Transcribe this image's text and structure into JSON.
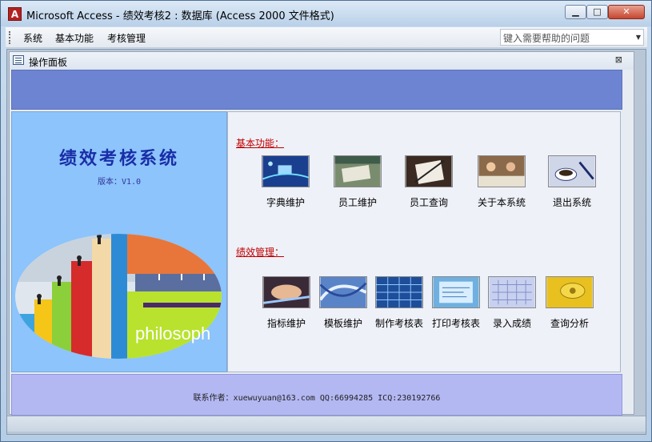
{
  "window": {
    "app_icon_letter": "A",
    "title": "Microsoft Access - 绩效考核2 : 数据库 (Access 2000 文件格式)",
    "min_glyph": "▁",
    "max_glyph": "□",
    "close_glyph": "✕"
  },
  "menubar": {
    "items": [
      "系统",
      "基本功能",
      "考核管理"
    ],
    "help_placeholder": "键入需要帮助的问题",
    "help_arrow": "▼"
  },
  "form": {
    "title": "操作面板",
    "close_glyph": "⊠"
  },
  "left": {
    "title": "绩效考核系统",
    "version": "版本：V1.0",
    "banner_text": "philosoph"
  },
  "sections": [
    {
      "label": "基本功能：",
      "items": [
        {
          "label": "字典维护",
          "icon": "network-computer-icon"
        },
        {
          "label": "员工维护",
          "icon": "documents-desk-icon"
        },
        {
          "label": "员工查询",
          "icon": "pen-notebook-icon"
        },
        {
          "label": "关于本系统",
          "icon": "meeting-people-icon"
        },
        {
          "label": "退出系统",
          "icon": "coffee-cup-icon"
        }
      ]
    },
    {
      "label": "绩效管理：",
      "items": [
        {
          "label": "指标维护",
          "icon": "handshake-icon"
        },
        {
          "label": "模板维护",
          "icon": "abstract-blue-icon"
        },
        {
          "label": "制作考核表",
          "icon": "blue-grid-icon"
        },
        {
          "label": "打印考核表",
          "icon": "blue-report-icon"
        },
        {
          "label": "录入成绩",
          "icon": "keyboard-icon"
        },
        {
          "label": "查询分析",
          "icon": "phone-keypad-icon"
        }
      ]
    }
  ],
  "footer": {
    "contact": "联系作者：xuewuyuan@163.com   QQ:66994285   ICQ:230192766"
  },
  "colors": {
    "top_band": "#6c84d1",
    "left_panel": "#8cc4fb",
    "bottom_band": "#b3b8f3",
    "section_label": "#c00000",
    "title_blue": "#1a2ea8"
  }
}
